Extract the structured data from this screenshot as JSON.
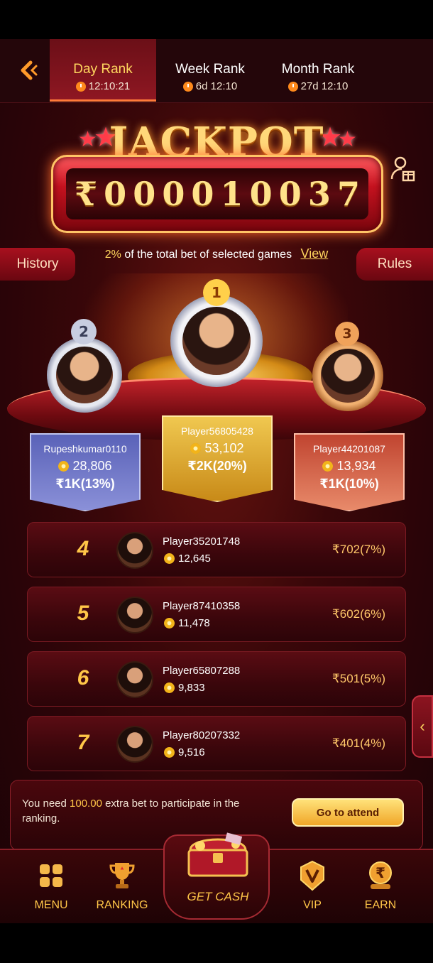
{
  "tabs": [
    {
      "label": "Day Rank",
      "timer": "12:10:21",
      "active": true
    },
    {
      "label": "Week Rank",
      "timer": "6d 12:10",
      "active": false
    },
    {
      "label": "Month Rank",
      "timer": "27d 12:10",
      "active": false
    }
  ],
  "jackpot": {
    "title": "JACKPOT",
    "digits": [
      "₹",
      "0",
      "0",
      "0",
      "0",
      "1",
      "0",
      "0",
      "3",
      "7"
    ]
  },
  "description": {
    "percent": "2%",
    "text": "of the total bet of selected games",
    "view_link": "View"
  },
  "side_buttons": {
    "history": "History",
    "rules": "Rules"
  },
  "podium": [
    {
      "place": "2",
      "name": "Rupeshkumar0110",
      "score": "28,806",
      "prize": "₹1K(13%)"
    },
    {
      "place": "1",
      "name": "Player56805428",
      "score": "53,102",
      "prize": "₹2K(20%)"
    },
    {
      "place": "3",
      "name": "Player44201087",
      "score": "13,934",
      "prize": "₹1K(10%)"
    }
  ],
  "list": [
    {
      "rank": "4",
      "name": "Player35201748",
      "score": "12,645",
      "prize": "₹702(7%)"
    },
    {
      "rank": "5",
      "name": "Player87410358",
      "score": "11,478",
      "prize": "₹602(6%)"
    },
    {
      "rank": "6",
      "name": "Player65807288",
      "score": "9,833",
      "prize": "₹501(5%)"
    },
    {
      "rank": "7",
      "name": "Player80207332",
      "score": "9,516",
      "prize": "₹401(4%)"
    }
  ],
  "attend": {
    "text_before": "You need",
    "amount": "100.00",
    "text_after": "extra bet to participate in the ranking.",
    "button": "Go to attend"
  },
  "nav": [
    {
      "label": "MENU",
      "icon": "menu-grid-icon"
    },
    {
      "label": "RANKING",
      "icon": "trophy-icon"
    },
    {
      "label": "GET CASH",
      "icon": "treasure-chest-icon"
    },
    {
      "label": "VIP",
      "icon": "vip-badge-icon"
    },
    {
      "label": "EARN",
      "icon": "rupee-earn-icon"
    }
  ],
  "colors": {
    "accent": "#ffc648",
    "primary_red": "#8e1722",
    "background": "#2a0408"
  }
}
